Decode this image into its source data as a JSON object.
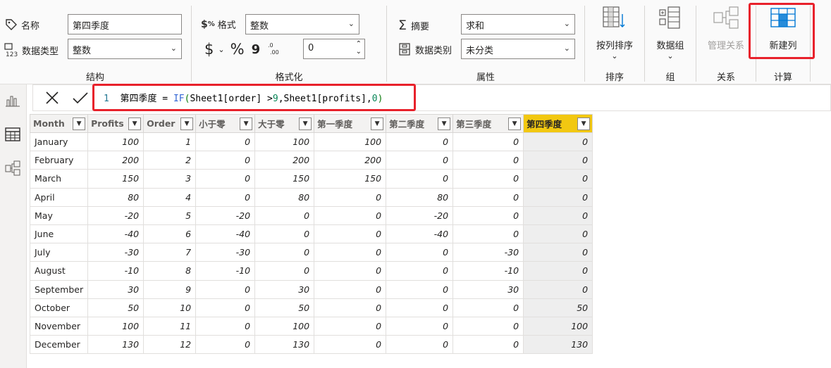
{
  "ribbon": {
    "structure": {
      "name_label": "名称",
      "name_value": "第四季度",
      "datatype_label": "数据类型",
      "datatype_value": "整数",
      "group_label": "结构"
    },
    "formatting": {
      "format_label": "格式",
      "format_value": "整数",
      "currency_symbol": "$",
      "percent_symbol": "%",
      "comma_symbol": "9",
      "decimals_value": "0",
      "group_label": "格式化"
    },
    "properties": {
      "summary_label": "摘要",
      "summary_value": "求和",
      "category_label": "数据类别",
      "category_value": "未分类",
      "group_label": "属性"
    },
    "sort": {
      "button_label": "按列排序",
      "group_label": "排序"
    },
    "groups": {
      "button_label": "数据组",
      "group_label": "组"
    },
    "relationships": {
      "button_label": "管理关系",
      "group_label": "关系"
    },
    "calculations": {
      "button_label": "新建列",
      "group_label": "计算"
    }
  },
  "formula_bar": {
    "line_number": "1",
    "formula_prefix": "第四季度 = ",
    "fn": "IF",
    "open_paren": "(",
    "args_a": "Sheet1[order] >",
    "num_9": "9",
    "args_b": ",Sheet1[profits],",
    "num_0": "0",
    "close_paren": ")"
  },
  "table": {
    "columns": [
      "Month",
      "Profits",
      "Order",
      "小于零",
      "大于零",
      "第一季度",
      "第二季度",
      "第三季度",
      "第四季度"
    ],
    "active_column": "第四季度",
    "rows": [
      [
        "January",
        "100",
        "1",
        "0",
        "100",
        "100",
        "0",
        "0",
        "0"
      ],
      [
        "February",
        "200",
        "2",
        "0",
        "200",
        "200",
        "0",
        "0",
        "0"
      ],
      [
        "March",
        "150",
        "3",
        "0",
        "150",
        "150",
        "0",
        "0",
        "0"
      ],
      [
        "April",
        "80",
        "4",
        "0",
        "80",
        "0",
        "80",
        "0",
        "0"
      ],
      [
        "May",
        "-20",
        "5",
        "-20",
        "0",
        "0",
        "-20",
        "0",
        "0"
      ],
      [
        "June",
        "-40",
        "6",
        "-40",
        "0",
        "0",
        "-40",
        "0",
        "0"
      ],
      [
        "July",
        "-30",
        "7",
        "-30",
        "0",
        "0",
        "0",
        "-30",
        "0"
      ],
      [
        "August",
        "-10",
        "8",
        "-10",
        "0",
        "0",
        "0",
        "-10",
        "0"
      ],
      [
        "September",
        "30",
        "9",
        "0",
        "30",
        "0",
        "0",
        "30",
        "0"
      ],
      [
        "October",
        "50",
        "10",
        "0",
        "50",
        "0",
        "0",
        "0",
        "50"
      ],
      [
        "November",
        "100",
        "11",
        "0",
        "100",
        "0",
        "0",
        "0",
        "100"
      ],
      [
        "December",
        "130",
        "12",
        "0",
        "130",
        "0",
        "0",
        "0",
        "130"
      ]
    ]
  },
  "colors": {
    "accent_yellow": "#f2c811",
    "highlight_red": "#e8212b",
    "ribbon_bg": "#fafafa"
  },
  "icons": {
    "rail": [
      "report-view-icon",
      "table-view-icon",
      "model-view-icon"
    ]
  }
}
